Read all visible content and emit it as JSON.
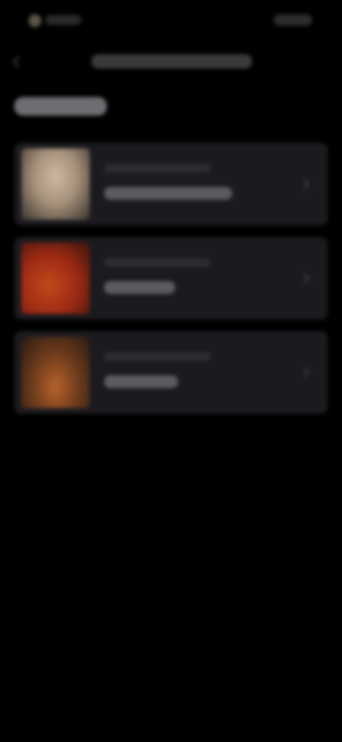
{
  "status_bar": {
    "time": "",
    "indicators": ""
  },
  "header": {
    "title": ""
  },
  "section": {
    "title": ""
  },
  "items": [
    {
      "subtitle": "",
      "title": ""
    },
    {
      "subtitle": "",
      "title": ""
    },
    {
      "subtitle": "",
      "title": ""
    }
  ],
  "icons": {
    "back": "back-arrow-icon",
    "chevron": "chevron-right-icon"
  },
  "colors": {
    "background": "#000000",
    "card": "#1b1b1f",
    "text_primary": "#e8e8ea",
    "text_secondary": "#8a8a90"
  }
}
